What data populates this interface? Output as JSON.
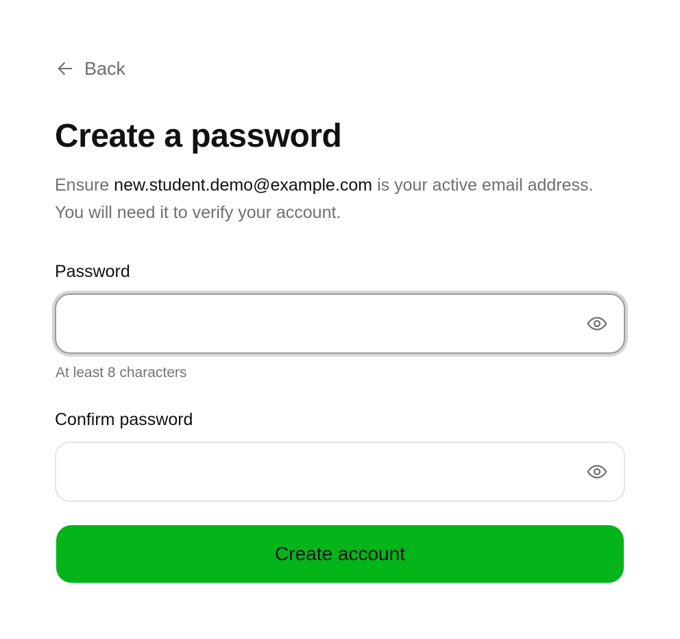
{
  "nav": {
    "back_label": "Back",
    "back_icon": "arrow-left-icon"
  },
  "header": {
    "title": "Create a password",
    "description_prefix": "Ensure ",
    "email": "new.student.demo@example.com",
    "description_suffix": " is your active email address. You will need it to verify your account."
  },
  "form": {
    "password": {
      "label": "Password",
      "value": "",
      "placeholder": "",
      "hint": "At least 8 characters",
      "toggle_icon": "eye-icon"
    },
    "confirm_password": {
      "label": "Confirm password",
      "value": "",
      "placeholder": "",
      "toggle_icon": "eye-icon"
    },
    "submit_label": "Create account"
  },
  "colors": {
    "accent": "#04b51a",
    "text_primary": "#111111",
    "text_secondary": "#6f6f6f"
  }
}
